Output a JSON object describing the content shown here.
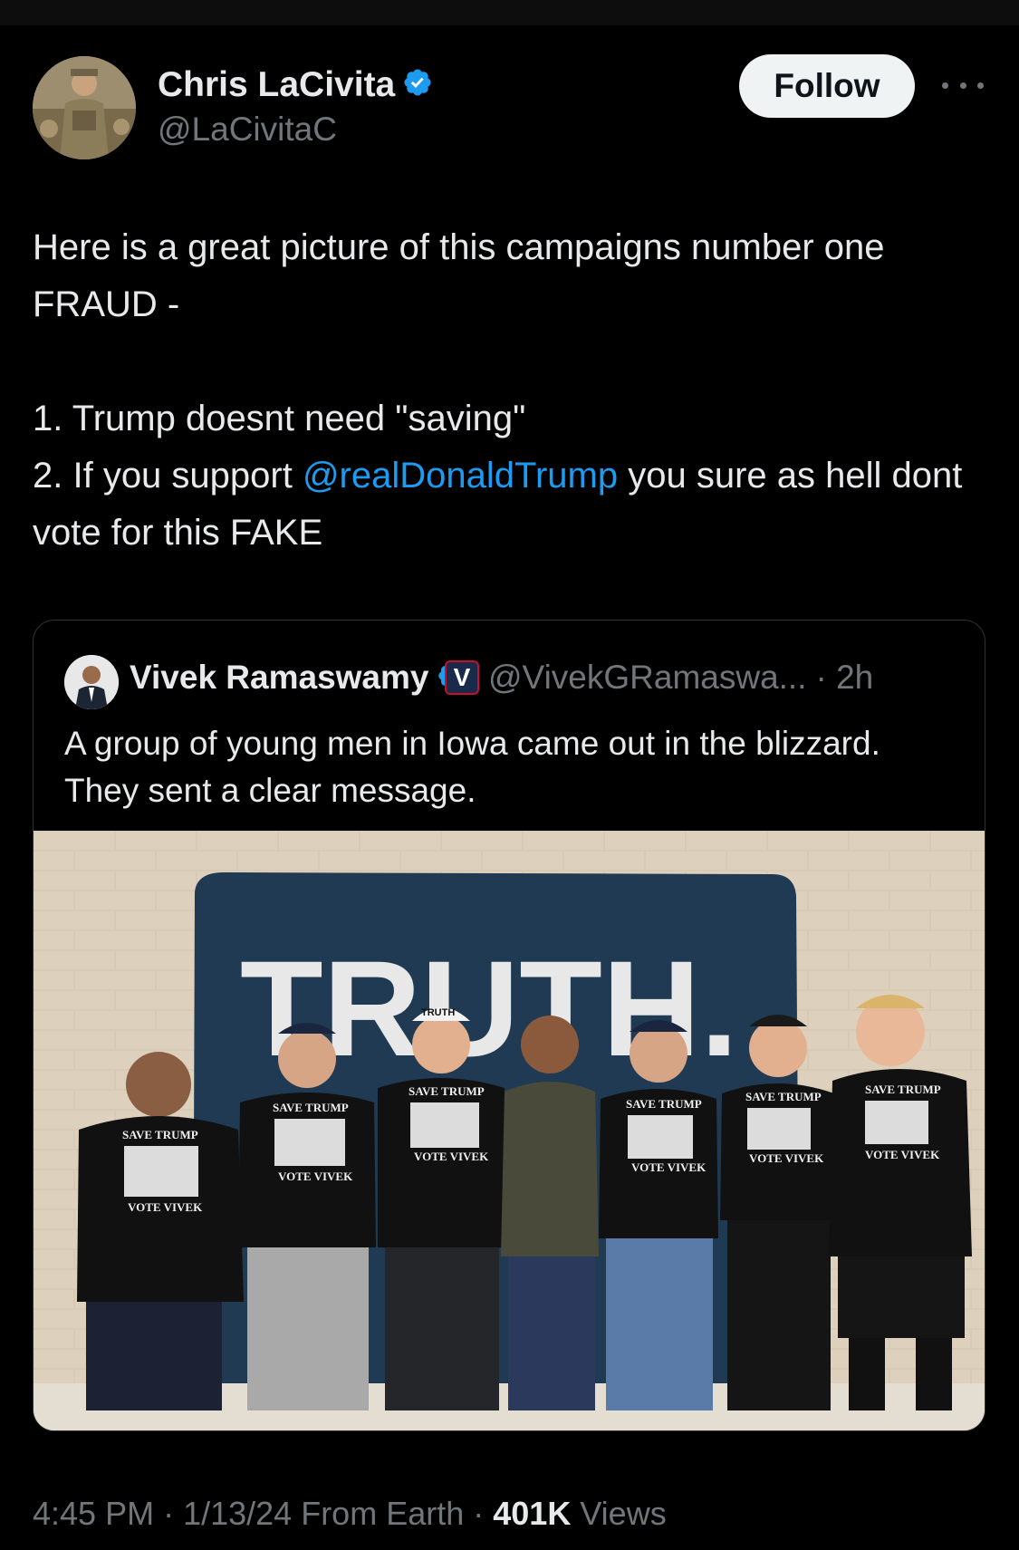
{
  "author": {
    "name": "Chris LaCivita",
    "handle": "@LaCivitaC"
  },
  "follow_label": "Follow",
  "tweet": {
    "line1": "Here is a great picture of this campaigns number one FRAUD -",
    "line2": "1. Trump doesnt need \"saving\"",
    "line3_pre": "2. If you support ",
    "line3_mention": "@realDonaldTrump",
    "line3_post": " you sure as hell dont vote for this FAKE"
  },
  "quote": {
    "name": "Vivek Ramaswamy",
    "badge_letter": "V",
    "handle": "@VivekGRamaswa...",
    "time": "· 2h",
    "text1": "A group of young men in Iowa came out in the blizzard.",
    "text2": "They sent a clear message.",
    "photo": {
      "banner_text": "TRUTH.",
      "shirt_top": "SAVE TRUMP",
      "shirt_bottom": "VOTE VIVEK",
      "cap_text": "TRUTH"
    }
  },
  "footer": {
    "time": "4:45 PM",
    "sep1": " · ",
    "date": "1/13/24",
    "source": " From Earth",
    "sep2": " · ",
    "views_count": "401K",
    "views_label": " Views"
  },
  "colors": {
    "background": "#000000",
    "text": "#e7e9ea",
    "secondary": "#71767b",
    "accent": "#1d9bf0",
    "border": "#2f3336"
  }
}
